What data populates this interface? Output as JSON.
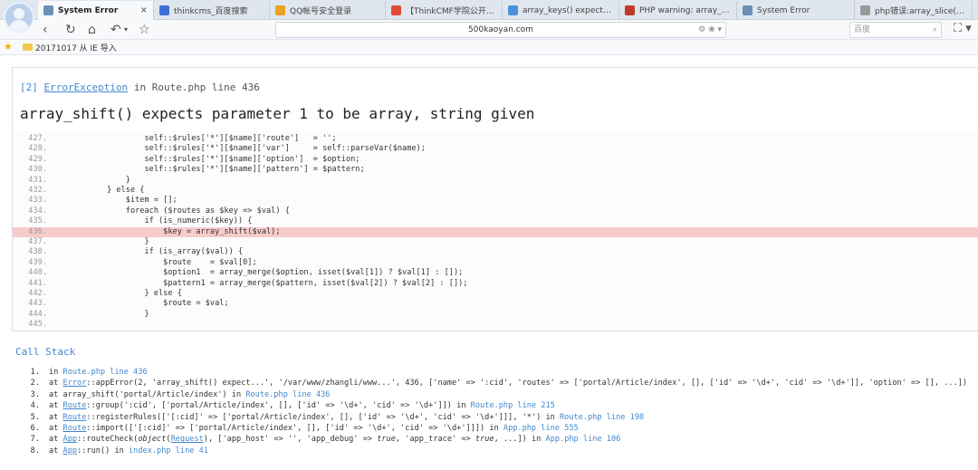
{
  "tabs": [
    {
      "label": "System Error",
      "icon": "page-icon",
      "color": "#6b8fb5",
      "active": true,
      "close": "×"
    },
    {
      "label": "thinkcms_百度搜索",
      "icon": "baidu-icon",
      "color": "#3b6fd6",
      "active": false,
      "close": ""
    },
    {
      "label": "QQ帐号安全登录",
      "icon": "qq-icon",
      "color": "#f0a020",
      "active": false,
      "close": ""
    },
    {
      "label": "【ThinkCMF学院公开课...",
      "icon": "thinkcmf-icon",
      "color": "#e04a3a",
      "active": false,
      "close": ""
    },
    {
      "label": "array_keys() expects para...",
      "icon": "globe-icon",
      "color": "#4a90d9",
      "active": false,
      "close": ""
    },
    {
      "label": "PHP warning: array_shift...",
      "icon": "php-icon",
      "color": "#c0392b",
      "active": false,
      "close": ""
    },
    {
      "label": "System Error",
      "icon": "page-icon",
      "color": "#6b8fb5",
      "active": false,
      "close": ""
    },
    {
      "label": "php错误:array_slice() exp...",
      "icon": "loading-icon",
      "color": "#999999",
      "active": false,
      "close": ""
    }
  ],
  "nav": {
    "url": "500kaoyan.com",
    "search_placeholder": "百度"
  },
  "bookmarks": {
    "folder_label": "20171017 从 IE 导入"
  },
  "exception": {
    "code": "[2]",
    "class": "ErrorException",
    "location": " in Route.php line 436",
    "message": "array_shift() expects parameter 1 to be array, string given"
  },
  "source_lines": [
    {
      "no": "427.",
      "code": "                    self::$rules['*'][$name]['route']   = '';",
      "hl": false
    },
    {
      "no": "428.",
      "code": "                    self::$rules['*'][$name]['var']     = self::parseVar($name);",
      "hl": false
    },
    {
      "no": "429.",
      "code": "                    self::$rules['*'][$name]['option']  = $option;",
      "hl": false
    },
    {
      "no": "430.",
      "code": "                    self::$rules['*'][$name]['pattern'] = $pattern;",
      "hl": false
    },
    {
      "no": "431.",
      "code": "                }",
      "hl": false
    },
    {
      "no": "432.",
      "code": "            } else {",
      "hl": false
    },
    {
      "no": "433.",
      "code": "                $item = [];",
      "hl": false
    },
    {
      "no": "434.",
      "code": "                foreach ($routes as $key => $val) {",
      "hl": false
    },
    {
      "no": "435.",
      "code": "                    if (is_numeric($key)) {",
      "hl": false
    },
    {
      "no": "436.",
      "code": "                        $key = array_shift($val);",
      "hl": true
    },
    {
      "no": "437.",
      "code": "                    }",
      "hl": false
    },
    {
      "no": "438.",
      "code": "                    if (is_array($val)) {",
      "hl": false
    },
    {
      "no": "439.",
      "code": "                        $route    = $val[0];",
      "hl": false
    },
    {
      "no": "440.",
      "code": "                        $option1  = array_merge($option, isset($val[1]) ? $val[1] : []);",
      "hl": false
    },
    {
      "no": "441.",
      "code": "                        $pattern1 = array_merge($pattern, isset($val[2]) ? $val[2] : []);",
      "hl": false
    },
    {
      "no": "442.",
      "code": "                    } else {",
      "hl": false
    },
    {
      "no": "443.",
      "code": "                        $route = $val;",
      "hl": false
    },
    {
      "no": "444.",
      "code": "                    }",
      "hl": false
    },
    {
      "no": "445.",
      "code": "",
      "hl": false
    }
  ],
  "callstack": {
    "title": "Call Stack",
    "items": [
      {
        "no": "1.",
        "parts": [
          [
            "t",
            "in "
          ],
          [
            "l",
            "Route.php line 436"
          ]
        ]
      },
      {
        "no": "2.",
        "parts": [
          [
            "t",
            "at "
          ],
          [
            "u",
            "Error"
          ],
          [
            "t",
            "::appError(2, 'array_shift() expect...', '/var/www/zhangli/www...', 436, ['name' => ':cid', 'routes' => ['portal/Article/index', [], ['id' => '\\d+', 'cid' => '\\d+']], 'option' => [], ...])"
          ]
        ]
      },
      {
        "no": "3.",
        "parts": [
          [
            "t",
            "at array_shift('portal/Article/index') in "
          ],
          [
            "l",
            "Route.php line 436"
          ]
        ]
      },
      {
        "no": "4.",
        "parts": [
          [
            "t",
            "at "
          ],
          [
            "u",
            "Route"
          ],
          [
            "t",
            "::group(':cid', ['portal/Article/index', [], ['id' => '\\d+', 'cid' => '\\d+']]) in "
          ],
          [
            "l",
            "Route.php line 215"
          ]
        ]
      },
      {
        "no": "5.",
        "parts": [
          [
            "t",
            "at "
          ],
          [
            "u",
            "Route"
          ],
          [
            "t",
            "::registerRules(['[:cid]' => ['portal/Article/index', [], ['id' => '\\d+', 'cid' => '\\d+']]], '*') in "
          ],
          [
            "l",
            "Route.php line 198"
          ]
        ]
      },
      {
        "no": "6.",
        "parts": [
          [
            "t",
            "at "
          ],
          [
            "u",
            "Route"
          ],
          [
            "t",
            "::import(['[:cid]' => ['portal/Article/index', [], ['id' => '\\d+', 'cid' => '\\d+']]]) in "
          ],
          [
            "l",
            "App.php line 555"
          ]
        ]
      },
      {
        "no": "7.",
        "parts": [
          [
            "t",
            "at "
          ],
          [
            "u",
            "App"
          ],
          [
            "t",
            "::routeCheck("
          ],
          [
            "i",
            "object"
          ],
          [
            "t",
            "("
          ],
          [
            "u",
            "Request"
          ],
          [
            "t",
            "), ['app_host' => '', 'app_debug' => "
          ],
          [
            "i",
            "true"
          ],
          [
            "t",
            ", 'app_trace' => "
          ],
          [
            "i",
            "true"
          ],
          [
            "t",
            ", ...]) in "
          ],
          [
            "l",
            "App.php line 106"
          ]
        ]
      },
      {
        "no": "8.",
        "parts": [
          [
            "t",
            "at "
          ],
          [
            "u",
            "App"
          ],
          [
            "t",
            "::run() in "
          ],
          [
            "l",
            "index.php line 41"
          ]
        ]
      }
    ]
  }
}
